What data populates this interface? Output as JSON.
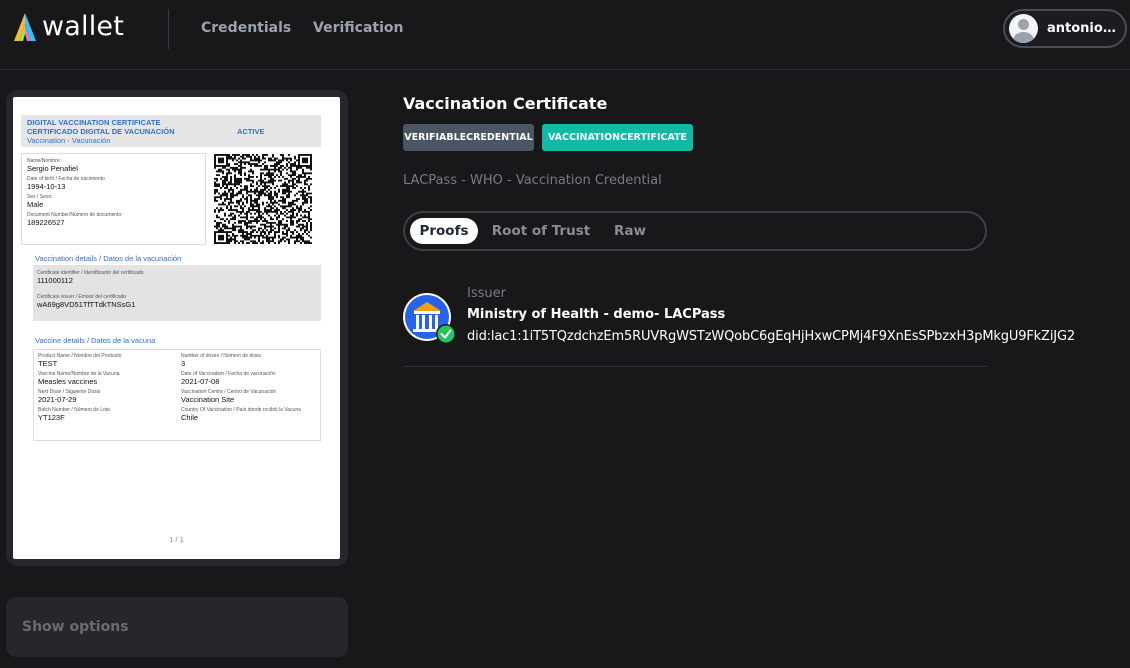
{
  "app": {
    "logo_text": "wallet"
  },
  "nav": {
    "items": [
      "Credentials",
      "Verification"
    ]
  },
  "user": {
    "name": "antonio ..."
  },
  "document": {
    "header": {
      "line1": "DIGITAL VACCINATION CERTIFICATE",
      "line2": "CERTIFICADO DIGITAL DE VACUNACIÓN",
      "line3": "Vaccination - Vacunación",
      "status": "ACTIVE"
    },
    "person": [
      {
        "label": "Name/Nombre:",
        "value": "Sergio Penafiel"
      },
      {
        "label": "Date of birth / Fecha de nacimiento",
        "value": "1994-10-13"
      },
      {
        "label": "Sex / Sexo:",
        "value": "Male"
      },
      {
        "label": "Document Number/Número de documento:",
        "value": "189226527"
      }
    ],
    "vaccination_details_title": "Vaccination details / Datos de la vacunación",
    "certificate": [
      {
        "label": "Certificate identifier / Identificador del certificado",
        "value": "111000112"
      },
      {
        "label": "Certificate issuer / Emisor del certificado",
        "value": "wA69g8VD51TfTTdkTNSsG1"
      }
    ],
    "vaccine_details_title": "Vaccine details / Datos de la vacuna",
    "vaccine_left": [
      {
        "label": "Product Name / Nombre del Producto",
        "value": "TEST"
      },
      {
        "label": "Vaccine Name/Nombre de la Vacuna",
        "value": "Measles vaccines"
      },
      {
        "label": "Next Dose / Siguiente Dosis",
        "value": "2021-07-29"
      },
      {
        "label": "Batch Number / Número de Lote",
        "value": "YT123F"
      }
    ],
    "vaccine_right": [
      {
        "label": "Number of doses / Número de dosis",
        "value": "3"
      },
      {
        "label": "Date of Vaccination / Fecha de vacunación",
        "value": "2021-07-08"
      },
      {
        "label": "Vaccination Centre / Centro de Vacunación",
        "value": "Vaccination Site"
      },
      {
        "label": "Country Of Vaccination / País donde recibió la Vacuna",
        "value": "Chile"
      }
    ],
    "page_indicator": "1 / 1"
  },
  "options": {
    "label": "Show options"
  },
  "credential": {
    "title": "Vaccination Certificate",
    "badges": [
      {
        "label": "VERIFIABLECREDENTIAL",
        "color": "#4b5563"
      },
      {
        "label": "VACCINATIONCERTIFICATE",
        "color": "#14b8a6"
      }
    ],
    "subtitle": "LACPass - WHO - Vaccination Credential",
    "tabs": [
      "Proofs",
      "Root of Trust",
      "Raw"
    ],
    "active_tab": "Proofs",
    "issuer": {
      "label": "Issuer",
      "name": "Ministry of Health - demo- LACPass",
      "did": "did:lac1:1iT5TQzdchzEm5RUVRgWSTzWQobC6gEqHjHxwCPMj4F9XnEsSPbzxH3pMkgU9FkZiJG2"
    }
  },
  "colors": {
    "background": "#18181b",
    "card": "#26262b",
    "accent_teal": "#14b8a6",
    "link_blue": "#2f6fd6",
    "verified_green": "#22c55e"
  }
}
